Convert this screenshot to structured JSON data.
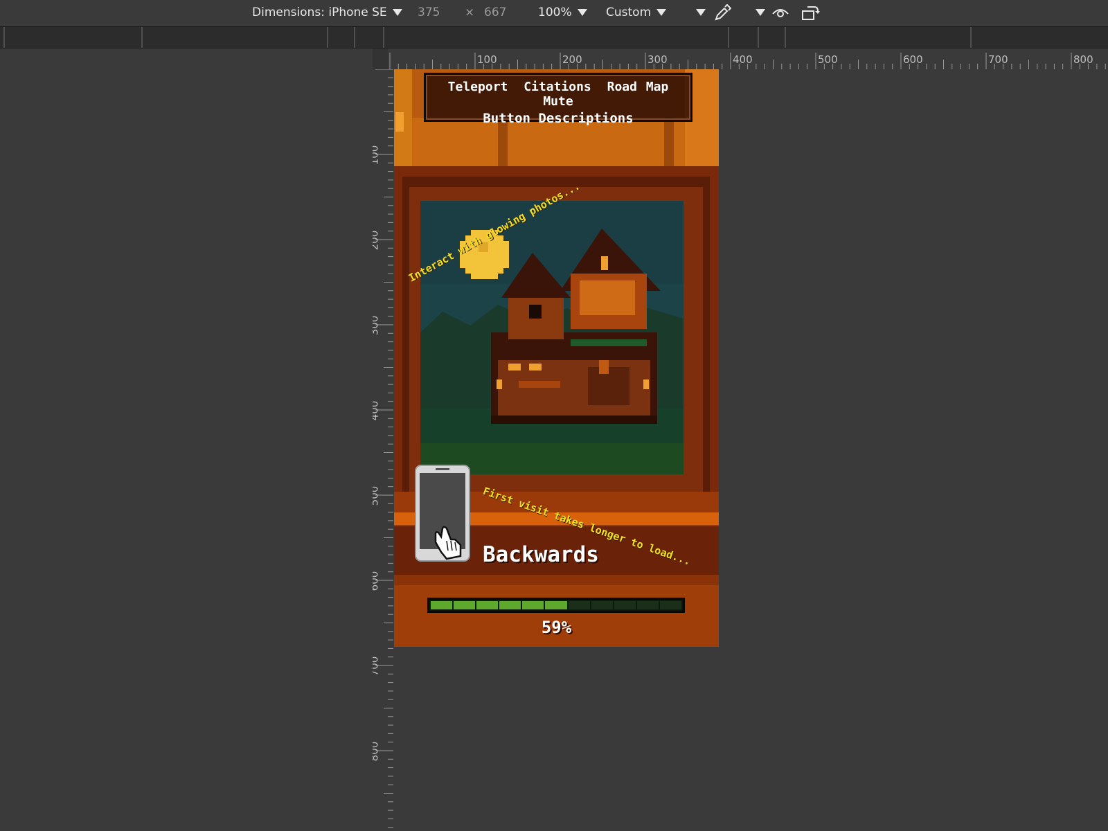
{
  "toolbar": {
    "dimensions_label": "Dimensions: iPhone SE",
    "width_value": "375",
    "times": "×",
    "height_value": "667",
    "zoom_label": "100%",
    "throttle_label": "Custom"
  },
  "rulers": {
    "horizontal": [
      "100",
      "200",
      "300",
      "400",
      "500",
      "600",
      "700",
      "800"
    ],
    "vertical": [
      "100",
      "200",
      "300",
      "400",
      "500",
      "600",
      "700",
      "800"
    ]
  },
  "game": {
    "menu": {
      "teleport": "Teleport",
      "citations": "Citations",
      "road_map": "Road Map",
      "mute": "Mute",
      "button_descriptions": "Button Descriptions"
    },
    "hint_top": "Interact with glowing photos...",
    "hint_bottom": "First visit takes longer to load...",
    "control_label": "Backwards",
    "progress_percent_text": "59%",
    "progress_fraction": 0.59,
    "progress_segments_total": 11
  },
  "colors": {
    "ui_background": "#3a3a3a",
    "hint_text": "#f0e020",
    "progress_filled": "#5ea82e",
    "progress_empty": "#1a2e1a"
  },
  "icons": {
    "dropdown": "chevron-down-icon",
    "eyedropper": "eyedropper-icon",
    "eye": "eye-icon",
    "rotate": "rotate-device-icon",
    "hand": "hand-pointer-icon"
  }
}
